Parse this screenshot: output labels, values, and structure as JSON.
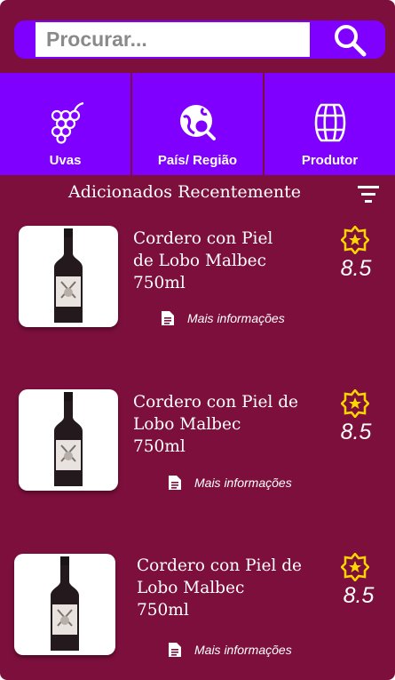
{
  "search": {
    "placeholder": "Procurar..."
  },
  "tabs": [
    {
      "label": "Uvas",
      "icon": "grapes-icon"
    },
    {
      "label": "País/ Região",
      "icon": "globe-search-icon"
    },
    {
      "label": "Produtor",
      "icon": "barrel-icon"
    }
  ],
  "section": {
    "title": "Adicionados Recentemente",
    "filter_icon": "filter-icon"
  },
  "wines": [
    {
      "name_lines": [
        "Cordero con Piel",
        "de Lobo Malbec",
        "750ml"
      ],
      "rating": "8.5",
      "more_info": "Mais informações"
    },
    {
      "name_lines": [
        "Cordero con Piel de",
        "Lobo Malbec",
        "750ml"
      ],
      "rating": "8.5",
      "more_info": "Mais informações"
    },
    {
      "name_lines": [
        "Cordero con Piel de",
        "Lobo Malbec",
        "750ml"
      ],
      "rating": "8.5",
      "more_info": "Mais informações"
    }
  ],
  "colors": {
    "background": "#7d0f3d",
    "accent": "#7f00ff",
    "star": "#ffd700"
  }
}
